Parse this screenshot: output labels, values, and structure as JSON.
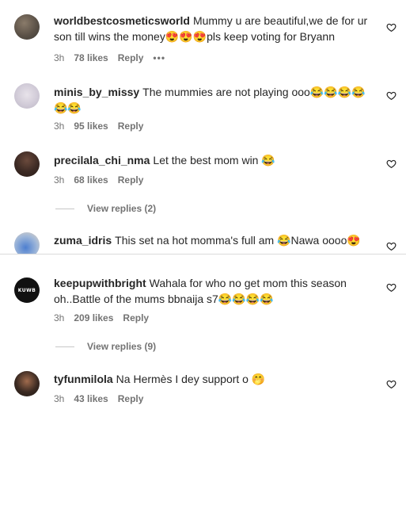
{
  "comments": [
    {
      "username": "worldbestcosmeticsworld",
      "text": "Mummy u are beautiful,we de for ur son till wins the money😍😍😍pls keep voting for Bryann",
      "time": "3h",
      "likes": "78 likes",
      "reply": "Reply",
      "more": "•••"
    },
    {
      "username": "minis_by_missy",
      "text": "The mummies are not playing ooo😂😂😂😂😂😂",
      "time": "3h",
      "likes": "95 likes",
      "reply": "Reply"
    },
    {
      "username": "precilala_chi_nma",
      "text": "Let the best mom win 😂",
      "time": "3h",
      "likes": "68 likes",
      "reply": "Reply",
      "view_replies": "View replies (2)"
    },
    {
      "username": "zuma_idris",
      "text": "This set na hot momma's full am 😂Nawa oooo😍"
    },
    {
      "username": "keepupwithbright",
      "avatar_text": "KUWB",
      "text": "Wahala for who no get mom this season oh..Battle of the mums bbnaija s7😂😂😂😂",
      "time": "3h",
      "likes": "209 likes",
      "reply": "Reply",
      "view_replies": "View replies (9)"
    },
    {
      "username": "tyfunmilola",
      "text": "Na Hermès I dey support o 🤭",
      "time": "3h",
      "likes": "43 likes",
      "reply": "Reply"
    }
  ]
}
